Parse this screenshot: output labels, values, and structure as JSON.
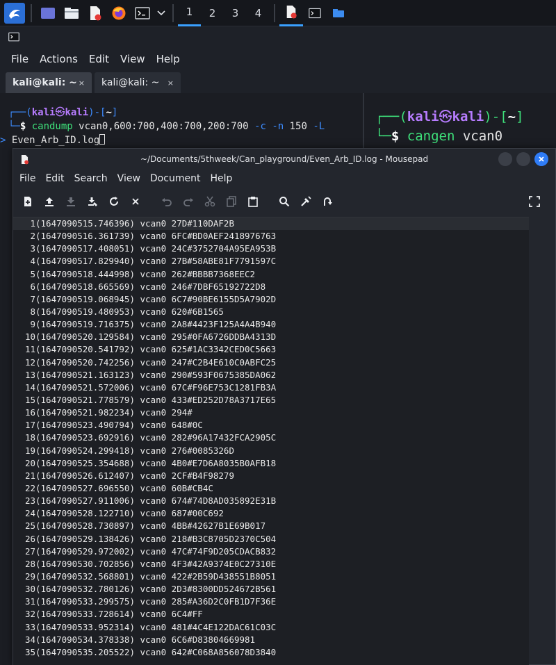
{
  "taskbar": {
    "workspaces": [
      "1",
      "2",
      "3",
      "4"
    ],
    "icons": [
      "kali-dragon-icon",
      "desktop-icon",
      "file-manager-icon",
      "text-editor-icon",
      "firefox-icon",
      "terminal-icon",
      "chevron-down-icon"
    ]
  },
  "terminal": {
    "menu": [
      "File",
      "Actions",
      "Edit",
      "View",
      "Help"
    ],
    "tabs": [
      {
        "label": "kali@kali: ~",
        "close": "×"
      },
      {
        "label": "kali@kali: ~",
        "close": "×"
      }
    ],
    "left_pane": {
      "prompt_top": "┌──(",
      "user": "kali",
      "at": "㉿",
      "host": "kali",
      "dir_open": ")-[",
      "dir": "~",
      "dir_close": "]",
      "prompt_bottom": "└─",
      "dollar": "$ ",
      "command": "candump",
      "args": " vcan0,600:700,400:700,200:700 ",
      "flag_c": "-c",
      "flag_n": " -n ",
      "flag_n_val": "150",
      "flag_L": " -L",
      "redirect": "> ",
      "redirect_file": "Even_Arb_ID.log"
    },
    "right_pane": {
      "prompt_top": "┌──(",
      "user": "kali",
      "at": "㉿",
      "host": "kali",
      "dir_open": ")-[",
      "dir": "~",
      "dir_close": "]",
      "prompt_bottom": "└─",
      "dollar": "$ ",
      "command": "cangen",
      "args": " vcan0"
    }
  },
  "mousepad": {
    "title": "~/Documents/5thweek/Can_playground/Even_Arb_ID.log - Mousepad",
    "menu": [
      "File",
      "Edit",
      "Search",
      "View",
      "Document",
      "Help"
    ],
    "lines": [
      "(1647090515.746396) vcan0 27D#110DAF2B",
      "(1647090516.361739) vcan0 6FC#BD0AEF2418976763",
      "(1647090517.408051) vcan0 24C#3752704A95EA953B",
      "(1647090517.829940) vcan0 27B#58ABE81F7791597C",
      "(1647090518.444998) vcan0 262#BBBB7368EEC2",
      "(1647090518.665569) vcan0 246#7DBF65192722D8",
      "(1647090519.068945) vcan0 6C7#90BE6155D5A7902D",
      "(1647090519.480953) vcan0 620#6B1565",
      "(1647090519.716375) vcan0 2A8#4423F125A4A4B940",
      "(1647090520.129584) vcan0 295#0FA6726DDBA4313D",
      "(1647090520.541792) vcan0 625#1AC3342CED0C5663",
      "(1647090520.742256) vcan0 247#C2B4E610C0ABFC25",
      "(1647090521.163123) vcan0 290#593F0675385DA062",
      "(1647090521.572006) vcan0 67C#F96E753C1281FB3A",
      "(1647090521.778579) vcan0 433#ED252D78A3717E65",
      "(1647090521.982234) vcan0 294#",
      "(1647090523.490794) vcan0 648#0C",
      "(1647090523.692916) vcan0 282#96A17432FCA2905C",
      "(1647090524.299418) vcan0 276#0085326D",
      "(1647090525.354688) vcan0 4B0#E7D6A8035B0AFB18",
      "(1647090526.612407) vcan0 2CF#B4F98279",
      "(1647090527.696550) vcan0 60B#CB4C",
      "(1647090527.911006) vcan0 674#74D8AD035892E31B",
      "(1647090528.122710) vcan0 687#00C692",
      "(1647090528.730897) vcan0 4BB#42627B1E69B017",
      "(1647090529.138426) vcan0 218#B3C8705D2370C504",
      "(1647090529.972002) vcan0 47C#74F9D205CDACB832",
      "(1647090530.702856) vcan0 4F3#42A9374E0C27310E",
      "(1647090532.568801) vcan0 422#2B59D438551B8051",
      "(1647090532.780126) vcan0 2D3#8300DD524672B561",
      "(1647090533.299575) vcan0 285#A36D2C0FB1D7F36E",
      "(1647090533.728614) vcan0 6C4#FF",
      "(1647090533.952314) vcan0 481#4C4E122DAC61C03C",
      "(1647090534.378338) vcan0 6C6#D83804669981",
      "(1647090535.205522) vcan0 642#C068A856078D3840"
    ]
  }
}
